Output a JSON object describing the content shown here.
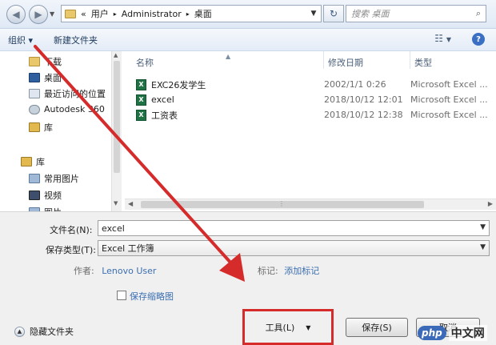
{
  "address_bar": {
    "breadcrumb": [
      "«",
      "用户",
      "▸",
      "Administrator",
      "▸",
      "桌面"
    ],
    "search_placeholder": "搜索 桌面"
  },
  "toolbar": {
    "organize_label": "组织 ▾",
    "new_folder_label": "新建文件夹",
    "help_label": "?"
  },
  "nav_pane": {
    "items": [
      "下载",
      "桌面",
      "最近访问的位置",
      "Autodesk 360",
      "库"
    ],
    "library_group": "库",
    "library_items": [
      "常用图片",
      "视频",
      "图片"
    ]
  },
  "file_list": {
    "columns": [
      "名称",
      "修改日期",
      "类型"
    ],
    "rows": [
      {
        "name": "EXC26发学生",
        "date": "2002/1/1 0:26",
        "type": "Microsoft Excel ..."
      },
      {
        "name": "excel",
        "date": "2018/10/12 12:01",
        "type": "Microsoft Excel ..."
      },
      {
        "name": "工资表",
        "date": "2018/10/12 12:38",
        "type": "Microsoft Excel ..."
      }
    ]
  },
  "form": {
    "filename_label": "文件名(N):",
    "filename_value": "excel",
    "filetype_label": "保存类型(T):",
    "filetype_value": "Excel 工作簿",
    "author_label": "作者:",
    "author_value": "Lenovo User",
    "tags_label": "标记:",
    "tags_value": "添加标记",
    "thumbnail_label": "保存缩略图"
  },
  "buttons": {
    "hide_folders": "隐藏文件夹",
    "tools": "工具(L)",
    "save": "保存(S)",
    "cancel": "取消"
  },
  "watermark": {
    "logo": "php",
    "text": "中文网"
  },
  "colors": {
    "annotation_red": "#d62b2b",
    "link_blue": "#3c6fb0",
    "excel_green": "#1f7244"
  }
}
